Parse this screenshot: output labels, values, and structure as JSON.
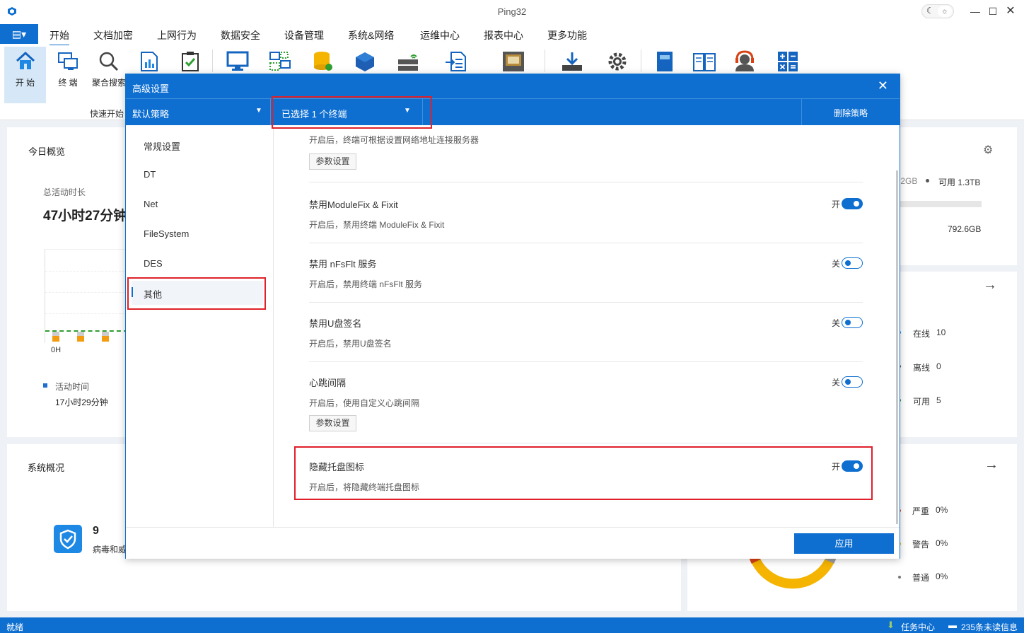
{
  "window": {
    "title": "Ping32"
  },
  "menu": {
    "app_button": "▤▾",
    "items": [
      "开始",
      "文档加密",
      "上网行为",
      "数据安全",
      "设备管理",
      "系统&网络",
      "运维中心",
      "报表中心",
      "更多功能"
    ]
  },
  "ribbon": {
    "buttons": [
      "开 始",
      "终 端",
      "聚合搜索"
    ],
    "group_label": "快速开始"
  },
  "dashboard": {
    "today_title": "今日概览",
    "total_active_label": "总活动时长",
    "total_active_value": "47小时27分钟",
    "chart_x_start": "0H",
    "legend_active": "活动时间",
    "legend_active_value": "17小时29分钟",
    "system_title": "系统概况",
    "virus_count": "9",
    "virus_label": "病毒和威胁",
    "disk_used_partial": ".2GB",
    "disk_available": "可用 1.3TB",
    "disk_value2": "792.6GB",
    "online": "在线",
    "online_count": "10",
    "offline": "离线",
    "offline_count": "0",
    "available": "可用",
    "available_count": "5",
    "severe": "严重",
    "severe_pct": "0%",
    "warning": "警告",
    "warning_pct": "0%",
    "normal": "普通",
    "normal_pct": "0%"
  },
  "dialog": {
    "title": "高级设置",
    "policy_select": "默认策略",
    "terminal_select": "已选择 1 个终端",
    "delete_policy": "删除策略",
    "sidebar": [
      "常规设置",
      "DT",
      "Net",
      "FileSystem",
      "DES",
      "其他"
    ],
    "top_desc": "开启后，终端可根据设置网络地址连接服务器",
    "param_label": "参数设置",
    "settings": [
      {
        "name": "禁用ModuleFix & Fixit",
        "desc": "开启后，禁用终端 ModuleFix & Fixit",
        "state_label": "开",
        "on": true
      },
      {
        "name": "禁用 nFsFlt 服务",
        "desc": "开启后，禁用终端 nFsFlt 服务",
        "state_label": "关",
        "on": false
      },
      {
        "name": "禁用U盘签名",
        "desc": "开启后，禁用U盘签名",
        "state_label": "关",
        "on": false
      },
      {
        "name": "心跳间隔",
        "desc": "开启后，使用自定义心跳间隔",
        "state_label": "关",
        "on": false
      },
      {
        "name": "隐藏托盘图标",
        "desc": "开启后，将隐藏终端托盘图标",
        "state_label": "开",
        "on": true
      }
    ],
    "apply": "应用"
  },
  "statusbar": {
    "left": "就绪",
    "task_center": "任务中心",
    "unread": "235条未读信息"
  },
  "colors": {
    "accent": "#0e6fd1",
    "highlight": "#e0202a"
  }
}
